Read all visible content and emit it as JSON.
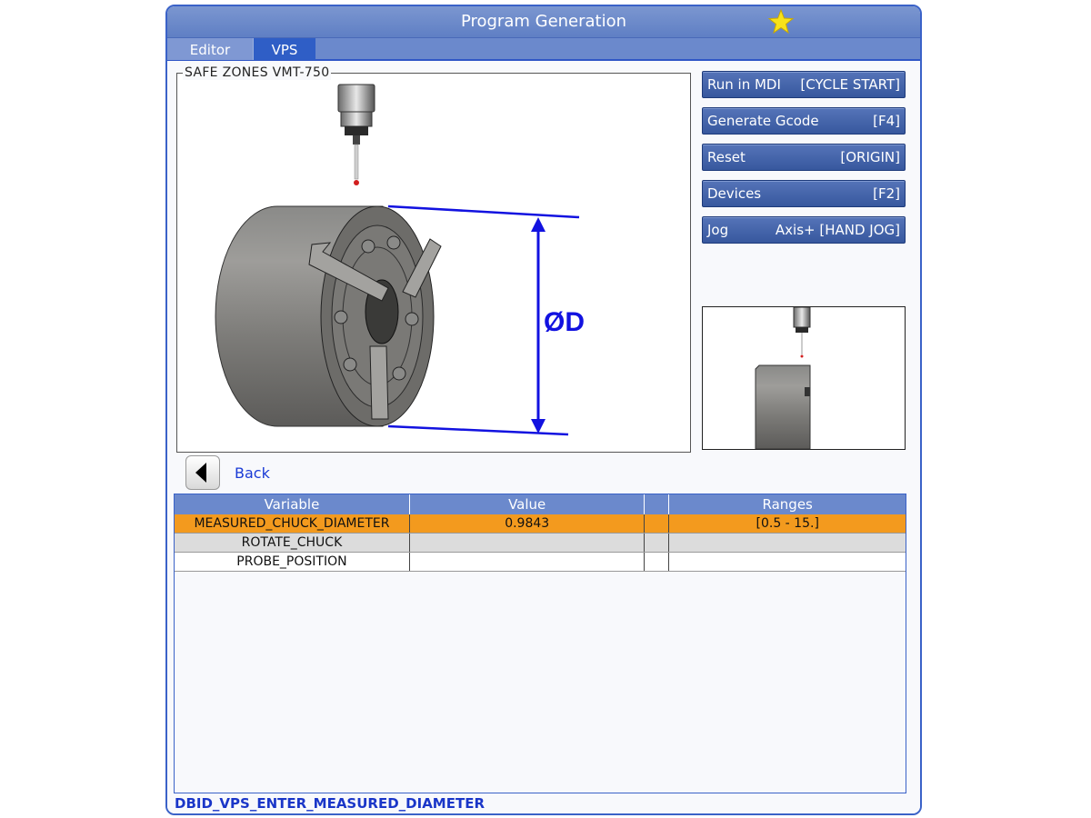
{
  "window": {
    "title": "Program Generation"
  },
  "tabs": [
    {
      "label": "Editor",
      "active": false
    },
    {
      "label": "VPS",
      "active": true
    }
  ],
  "safe_zones": {
    "title": "SAFE ZONES VMT-750",
    "diameter_label": "ØD"
  },
  "side_buttons": [
    {
      "label": "Run in MDI",
      "key": "[CYCLE START]"
    },
    {
      "label": "Generate Gcode",
      "key": "[F4]"
    },
    {
      "label": "Reset",
      "key": "[ORIGIN]"
    },
    {
      "label": "Devices",
      "key": "[F2]"
    },
    {
      "label": "Jog",
      "key": "Axis+ [HAND JOG]"
    }
  ],
  "back": {
    "label": "Back"
  },
  "table": {
    "headers": [
      "Variable",
      "Value",
      "",
      "Ranges"
    ],
    "rows": [
      {
        "variable": "MEASURED_CHUCK_DIAMETER",
        "value": "0.9843",
        "extra": "",
        "range": "[0.5 - 15.]"
      },
      {
        "variable": "ROTATE_CHUCK",
        "value": "",
        "extra": "",
        "range": ""
      },
      {
        "variable": "PROBE_POSITION",
        "value": "",
        "extra": "",
        "range": ""
      }
    ]
  },
  "status": "DBID_VPS_ENTER_MEASURED_DIAMETER",
  "colors": {
    "accent": "#2f5ec6",
    "selected_row": "#f39a1e",
    "dimension": "#1212e0",
    "status_text": "#1a36c8"
  }
}
